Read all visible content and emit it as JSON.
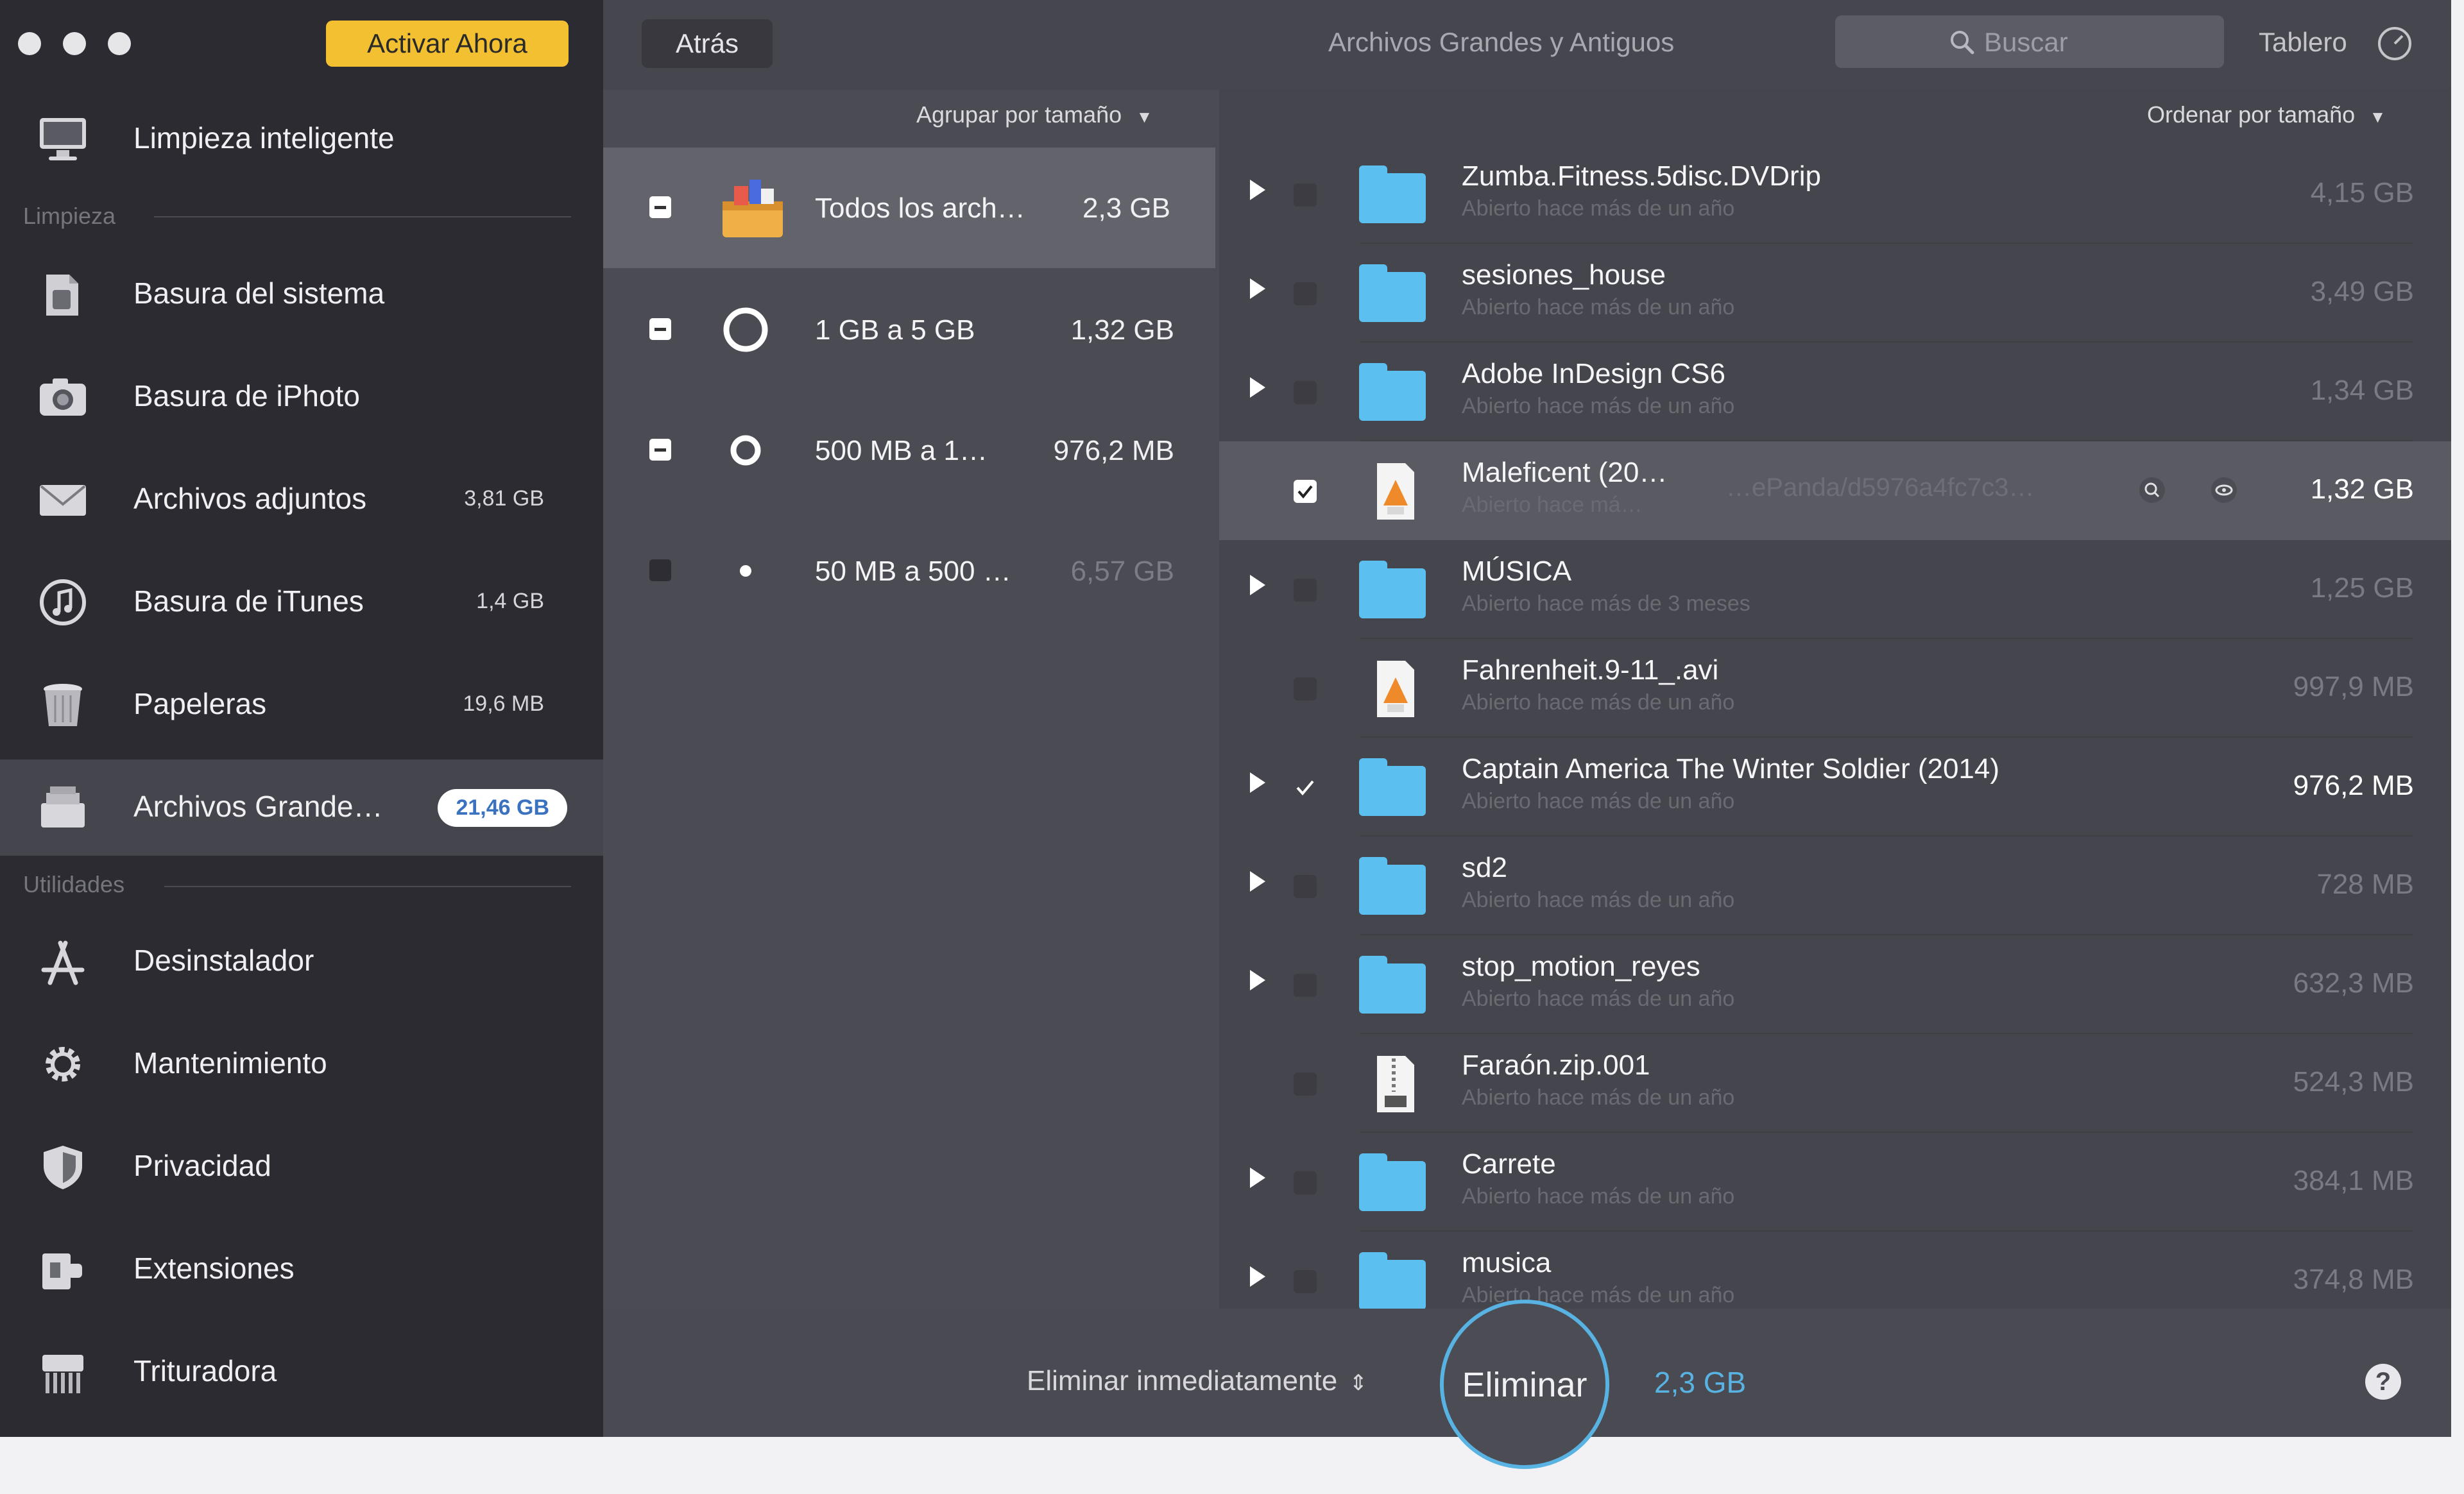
{
  "window": {
    "title": "Archivos Grandes y Antiguos"
  },
  "sidebar": {
    "activate_label": "Activar Ahora",
    "top_item": {
      "label": "Limpieza inteligente",
      "icon": "monitor-icon"
    },
    "section_cleanup": "Limpieza",
    "cleanup_items": [
      {
        "label": "Basura del sistema",
        "value": "",
        "icon": "system-trash-icon"
      },
      {
        "label": "Basura de iPhoto",
        "value": "",
        "icon": "camera-icon"
      },
      {
        "label": "Archivos adjuntos",
        "value": "3,81 GB",
        "icon": "mail-icon"
      },
      {
        "label": "Basura de iTunes",
        "value": "1,4 GB",
        "icon": "music-note-icon"
      },
      {
        "label": "Papeleras",
        "value": "19,6 MB",
        "icon": "trash-bin-icon"
      },
      {
        "label": "Archivos Grande…",
        "value": "21,46 GB",
        "icon": "large-files-icon"
      }
    ],
    "section_utilities": "Utilidades",
    "utility_items": [
      {
        "label": "Desinstalador",
        "icon": "app-store-icon"
      },
      {
        "label": "Mantenimiento",
        "icon": "gear-icon"
      },
      {
        "label": "Privacidad",
        "icon": "shield-icon"
      },
      {
        "label": "Extensiones",
        "icon": "puzzle-icon"
      },
      {
        "label": "Trituradora",
        "icon": "shredder-icon"
      }
    ]
  },
  "toolbar": {
    "back_label": "Atrás",
    "search_placeholder": "Buscar",
    "dashboard_label": "Tablero"
  },
  "groups": {
    "group_by_label": "Agrupar por tamaño",
    "items": [
      {
        "label": "Todos los arch…",
        "size": "2,3 GB",
        "icon": "all-files-box-icon"
      },
      {
        "label": "1 GB a 5 GB",
        "size": "1,32 GB",
        "icon": "large-circle-icon"
      },
      {
        "label": "500 MB a 1…",
        "size": "976,2 MB",
        "icon": "medium-circle-icon"
      },
      {
        "label": "50 MB a 500 …",
        "size": "6,57 GB",
        "icon": "small-dot-icon"
      }
    ]
  },
  "files": {
    "sort_label": "Ordenar por tamaño",
    "items": [
      {
        "name": "Zumba.Fitness.5disc.DVDrip",
        "sub": "Abierto hace más de un año",
        "size": "4,15 GB",
        "kind": "folder",
        "checked": false
      },
      {
        "name": "sesiones_house",
        "sub": "Abierto hace más de un año",
        "size": "3,49 GB",
        "kind": "folder",
        "checked": false
      },
      {
        "name": "Adobe InDesign CS6",
        "sub": "Abierto hace más de un año",
        "size": "1,34 GB",
        "kind": "folder",
        "checked": false
      },
      {
        "name": "Maleficent (20…",
        "sub": "Abierto hace má…",
        "size": "1,32 GB",
        "kind": "video",
        "checked": true,
        "path": "…ePanda/d5976a4fc7c3…"
      },
      {
        "name": "MÚSICA",
        "sub": "Abierto hace más de 3 meses",
        "size": "1,25 GB",
        "kind": "folder",
        "checked": false
      },
      {
        "name": "Fahrenheit.9-11_.avi",
        "sub": "Abierto hace más de un año",
        "size": "997,9 MB",
        "kind": "video",
        "checked": false
      },
      {
        "name": "Captain America The Winter Soldier (2014)",
        "sub": "Abierto hace más de un año",
        "size": "976,2 MB",
        "kind": "folder",
        "checked": true
      },
      {
        "name": "sd2",
        "sub": "Abierto hace más de un año",
        "size": "728 MB",
        "kind": "folder",
        "checked": false
      },
      {
        "name": "stop_motion_reyes",
        "sub": "Abierto hace más de un año",
        "size": "632,3 MB",
        "kind": "folder",
        "checked": false
      },
      {
        "name": "Faraón.zip.001",
        "sub": "Abierto hace más de un año",
        "size": "524,3 MB",
        "kind": "zip",
        "checked": false
      },
      {
        "name": "Carrete",
        "sub": "Abierto hace más de un año",
        "size": "384,1 MB",
        "kind": "folder",
        "checked": false
      },
      {
        "name": "musica",
        "sub": "Abierto hace más de un año",
        "size": "374,8 MB",
        "kind": "folder",
        "checked": false
      }
    ]
  },
  "footer": {
    "delete_mode_label": "Eliminar inmediatamente",
    "delete_button": "Eliminar",
    "total_size": "2,3 GB",
    "help": "?"
  },
  "colors": {
    "accent": "#f2c031",
    "highlight": "#58b3e2",
    "folder": "#5bc0ef"
  }
}
